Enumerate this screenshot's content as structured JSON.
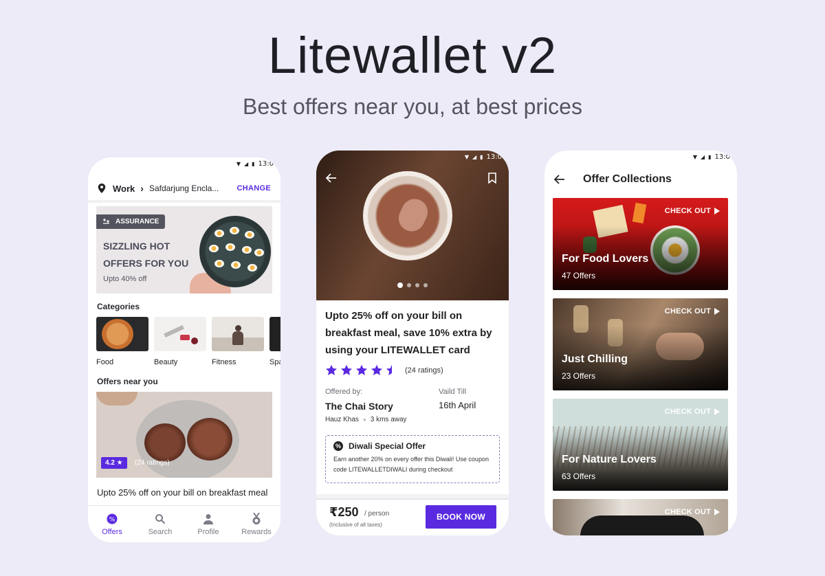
{
  "header": {
    "title": "Litewallet v2",
    "subtitle": "Best offers near you, at best prices"
  },
  "status_time": "13:0",
  "home": {
    "location": {
      "tag": "Work",
      "address": "Safdarjung Encla...",
      "change_label": "CHANGE"
    },
    "banner": {
      "badge": "ASSURANCE",
      "title": "SIZZLING HOT OFFERS FOR YOU",
      "subtitle": "Upto 40% off"
    },
    "categories_label": "Categories",
    "categories": [
      {
        "label": "Food"
      },
      {
        "label": "Beauty"
      },
      {
        "label": "Fitness"
      },
      {
        "label": "Spa"
      }
    ],
    "offers_label": "Offers near you",
    "offer": {
      "rating": "4.2 ★",
      "ratings_count": "(24 ratings)",
      "title": "Upto 25% off on your bill on breakfast meal"
    },
    "nav": [
      {
        "label": "Offers",
        "icon": "offers-icon",
        "active": true
      },
      {
        "label": "Search",
        "icon": "search-icon",
        "active": false
      },
      {
        "label": "Profile",
        "icon": "profile-icon",
        "active": false
      },
      {
        "label": "Rewards",
        "icon": "rewards-icon",
        "active": false
      }
    ]
  },
  "detail": {
    "title": "Upto 25% off on your bill on breakfast meal, save 10% extra by using your LITEWALLET card",
    "rating_stars": 4.5,
    "ratings_count": "(24 ratings)",
    "offered_by_label": "Offered by:",
    "merchant": "The Chai Story",
    "valid_label": "Vaild Till",
    "valid_till": "16th April",
    "area": "Hauz Khas",
    "distance": "3 kms away",
    "promo": {
      "title": "Diwali Special Offer",
      "body": "Earn another 20% on every offer this Diwali! Use coupon code LITEWALLETDIWALI during checkout"
    },
    "price": "₹250",
    "price_unit": "/ person",
    "price_note": "(Inclusive of all taxes)",
    "book_label": "BOOK NOW",
    "carousel_dots": 4
  },
  "collections": {
    "title": "Offer Collections",
    "checkout_label": "CHECK OUT",
    "cards": [
      {
        "title": "For Food Lovers",
        "count": "47 Offers"
      },
      {
        "title": "Just Chilling",
        "count": "23 Offers"
      },
      {
        "title": "For Nature Lovers",
        "count": "63 Offers"
      },
      {
        "title": "",
        "count": ""
      }
    ]
  },
  "colors": {
    "accent": "#5a2ae0",
    "background": "#ecebf7"
  }
}
